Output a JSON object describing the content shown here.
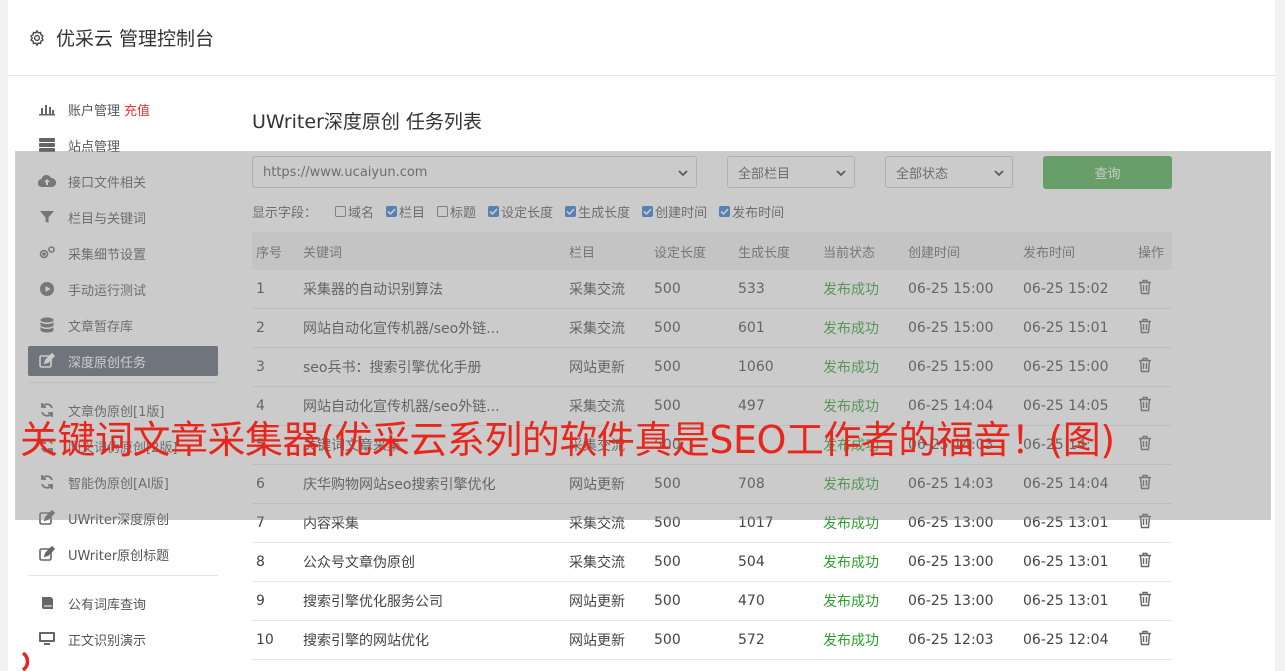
{
  "header": {
    "title": "优采云 管理控制台"
  },
  "sidebar": {
    "items": [
      {
        "label": "账户管理",
        "badge": "充值",
        "icon": "bar-chart-icon"
      },
      {
        "label": "站点管理",
        "icon": "server-icon"
      },
      {
        "label": "接口文件相关",
        "icon": "cloud-upload-icon"
      },
      {
        "label": "栏目与关键词",
        "icon": "filter-icon"
      },
      {
        "label": "采集细节设置",
        "icon": "cogs-icon"
      },
      {
        "label": "手动运行测试",
        "icon": "play-circle-icon"
      },
      {
        "label": "文章暂存库",
        "icon": "database-icon"
      },
      {
        "label": "深度原创任务",
        "icon": "edit-icon",
        "active": true
      }
    ],
    "items2": [
      {
        "label": "文章伪原创[1版]",
        "icon": "refresh-icon"
      },
      {
        "label": "同义词伪原创[2版]",
        "icon": "refresh-icon"
      },
      {
        "label": "智能伪原创[AI版]",
        "icon": "refresh-icon"
      },
      {
        "label": "UWriter深度原创",
        "icon": "edit-icon"
      },
      {
        "label": "UWriter原创标题",
        "icon": "edit-icon"
      }
    ],
    "items3": [
      {
        "label": "公有词库查询",
        "icon": "book-icon"
      },
      {
        "label": "正文识别演示",
        "icon": "monitor-icon"
      }
    ]
  },
  "page": {
    "title": "UWriter深度原创 任务列表",
    "site_select": "https://www.ucaiyun.com",
    "column_select": "全部栏目",
    "status_select": "全部状态",
    "query_button": "查询",
    "fields_label": "显示字段：",
    "fields": [
      {
        "label": "域名",
        "checked": false
      },
      {
        "label": "栏目",
        "checked": true
      },
      {
        "label": "标题",
        "checked": false
      },
      {
        "label": "设定长度",
        "checked": true
      },
      {
        "label": "生成长度",
        "checked": true
      },
      {
        "label": "创建时间",
        "checked": true
      },
      {
        "label": "发布时间",
        "checked": true
      }
    ]
  },
  "table": {
    "headers": [
      "序号",
      "关键词",
      "栏目",
      "设定长度",
      "生成长度",
      "当前状态",
      "创建时间",
      "发布时间",
      "操作"
    ],
    "rows": [
      [
        "1",
        "采集器的自动识别算法",
        "采集交流",
        "500",
        "533",
        "发布成功",
        "06-25 15:00",
        "06-25 15:02"
      ],
      [
        "2",
        "网站自动化宣传机器/seo外链...",
        "采集交流",
        "500",
        "601",
        "发布成功",
        "06-25 15:00",
        "06-25 15:01"
      ],
      [
        "3",
        "seo兵书：搜索引擎优化手册",
        "网站更新",
        "500",
        "1060",
        "发布成功",
        "06-25 15:00",
        "06-25 15:00"
      ],
      [
        "4",
        "网站自动化宣传机器/seo外链...",
        "采集交流",
        "500",
        "497",
        "发布成功",
        "06-25 14:04",
        "06-25 14:05"
      ],
      [
        "5",
        "关键词文章采集",
        "采集交流",
        "500",
        "",
        "发布成功",
        "06-25 14:03",
        "06-25 14:"
      ],
      [
        "6",
        "庆华购物网站seo搜索引擎优化",
        "网站更新",
        "500",
        "708",
        "发布成功",
        "06-25 14:03",
        "06-25 14:04"
      ],
      [
        "7",
        "内容采集",
        "采集交流",
        "500",
        "1017",
        "发布成功",
        "06-25 13:00",
        "06-25 13:01"
      ],
      [
        "8",
        "公众号文章伪原创",
        "采集交流",
        "500",
        "504",
        "发布成功",
        "06-25 13:00",
        "06-25 13:01"
      ],
      [
        "9",
        "搜索引擎优化服务公司",
        "网站更新",
        "500",
        "470",
        "发布成功",
        "06-25 13:00",
        "06-25 13:01"
      ],
      [
        "10",
        "搜索引擎的网站优化",
        "网站更新",
        "500",
        "572",
        "发布成功",
        "06-25 12:03",
        "06-25 12:04"
      ]
    ]
  },
  "banner": {
    "text": "关键词文章采集器(优采云系列的软件真是SEO工作者的福音！(图)"
  },
  "colors": {
    "active_nav": "#5a6372",
    "query_button": "#4cae4c",
    "success": "#2e9e2e",
    "banner": "#e8261c",
    "badge": "#e33333"
  }
}
